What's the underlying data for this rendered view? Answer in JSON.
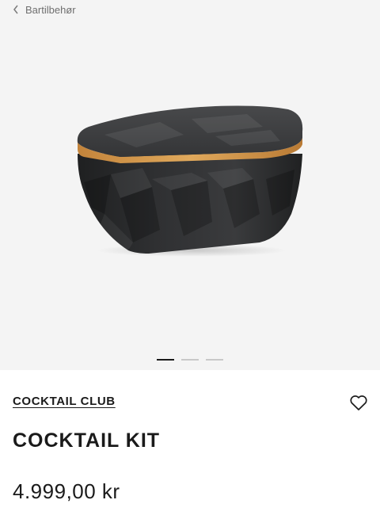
{
  "nav": {
    "back_label": "Bartilbehør",
    "back_icon": "chevron-left-icon"
  },
  "gallery": {
    "image_alt": "Cocktail kit box",
    "slide_count": 3,
    "active_slide": 1
  },
  "product": {
    "brand": "COCKTAIL CLUB",
    "title": "COCKTAIL KIT",
    "price": "4.999,00 kr",
    "favorite_icon": "heart-outline-icon"
  },
  "colors": {
    "gallery_background": "#f4f4f4",
    "text": "#1a1a1a",
    "muted": "#6f6f6f",
    "product_body": "#2c2c2d",
    "bamboo_band": "#d69a4c"
  }
}
